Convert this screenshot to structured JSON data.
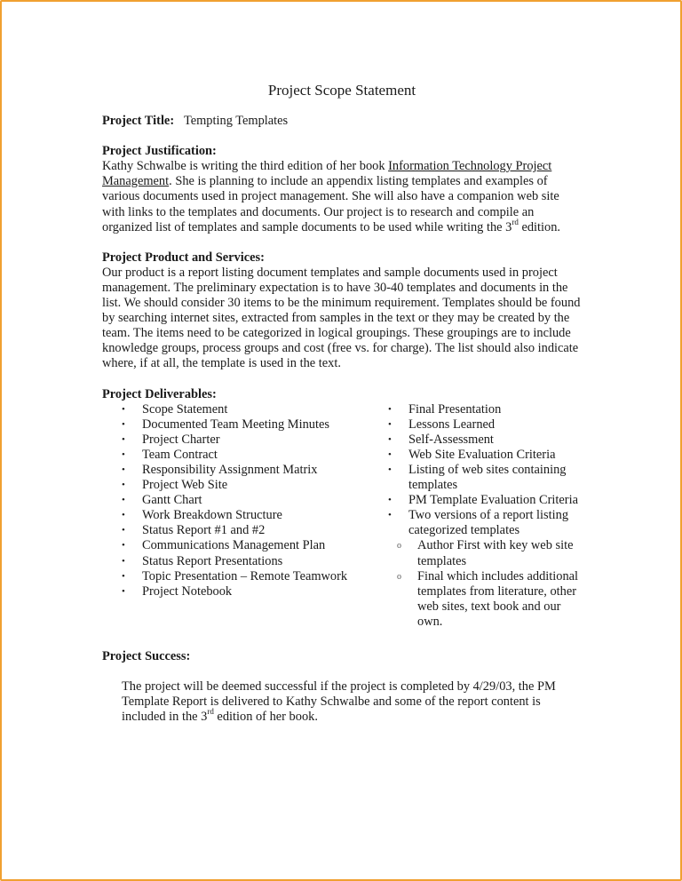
{
  "document": {
    "title": "Project Scope Statement",
    "project_title": {
      "label": "Project Title:",
      "value": "Tempting Templates"
    },
    "justification": {
      "heading": "Project Justification:",
      "text_before_link": "Kathy Schwalbe is writing the third edition of her book ",
      "book_title": "Information Technology Project Management",
      "text_after_link": ".   She is planning to include an appendix listing templates and examples of various documents used in project management.  She will also have a companion web site with links to the templates and documents.  Our project is to research and compile an organized list of templates and sample documents to be used while writing the 3",
      "superscript": "rd",
      "text_end": " edition."
    },
    "product": {
      "heading": "Project Product and Services:",
      "text": "Our product is a report listing document templates and sample documents used in project management.  The preliminary expectation is to have 30-40 templates and documents in the list.  We should consider 30 items to be the minimum requirement.  Templates should be found by searching internet sites, extracted from samples in the text or they may be created by the team.  The items need to be categorized in logical groupings.  These groupings are to include knowledge groups, process groups and cost (free vs. for charge).  The list should also indicate where, if at all, the template is used in the text."
    },
    "deliverables": {
      "heading": "Project Deliverables:",
      "bullet_glyph": "•",
      "sub_bullet_glyph": "o",
      "left": [
        "Scope Statement",
        "Documented Team Meeting Minutes",
        "Project Charter",
        "Team Contract",
        "Responsibility Assignment Matrix",
        "Project Web Site",
        "Gantt Chart",
        "Work Breakdown Structure",
        "Status Report #1 and #2",
        "Communications Management Plan",
        "Status Report Presentations",
        "Topic Presentation – Remote Teamwork",
        "Project Notebook"
      ],
      "right": [
        "Final Presentation",
        "Lessons Learned",
        "Self-Assessment",
        "Web Site Evaluation Criteria",
        "Listing of web sites containing templates",
        "PM Template Evaluation Criteria",
        "Two versions of a report listing categorized templates"
      ],
      "right_sub": [
        "Author First with key web site templates",
        "Final which includes additional templates from literature, other web sites, text book and our own."
      ]
    },
    "success": {
      "heading": "Project Success:",
      "text_before": "The project will be deemed successful if the project is completed by 4/29/03, the PM Template Report is delivered to Kathy Schwalbe and some of the report content is included in the 3",
      "superscript": "rd",
      "text_after": " edition of her book."
    },
    "colors": {
      "border": "#f0a030",
      "text": "#1a1a1a"
    }
  }
}
